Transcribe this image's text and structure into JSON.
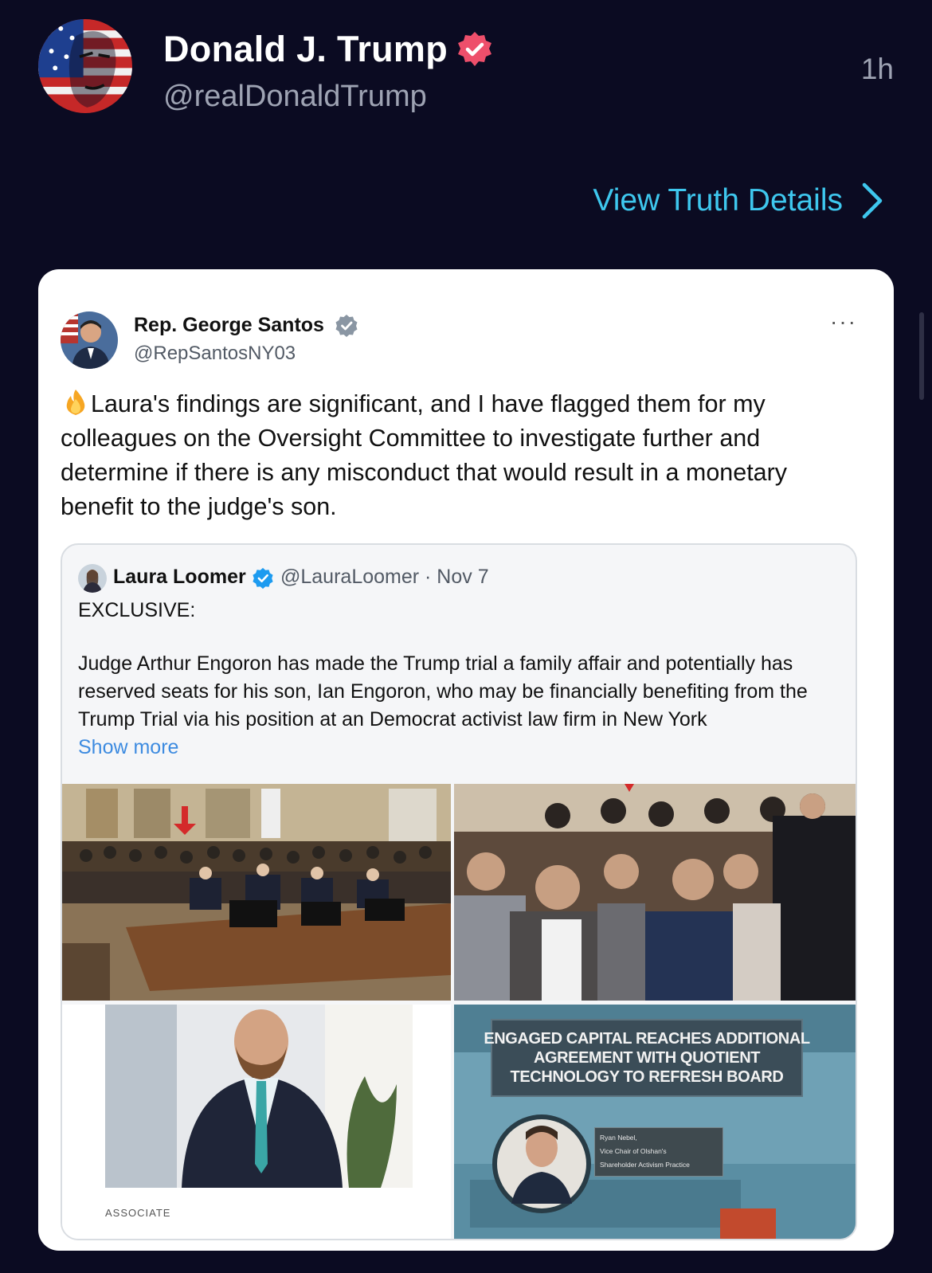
{
  "header": {
    "name": "Donald J. Trump",
    "handle": "@realDonaldTrump",
    "time": "1h",
    "view_details": "View Truth Details"
  },
  "colors": {
    "background": "#0b0b22",
    "accent_link": "#3ec7ee",
    "verified_badge": "#ee4f6b",
    "twitter_blue": "#1d9bf0"
  },
  "card": {
    "author": {
      "name": "Rep. George Santos",
      "handle": "@RepSantosNY03",
      "more": "···"
    },
    "body": "Laura's findings are significant, and I have flagged them for my colleagues on the Oversight Committee to investigate further and determine if there is any misconduct that would result in a monetary benefit to the judge's son.",
    "quote": {
      "name": "Laura Loomer",
      "handle_date": "@LauraLoomer · Nov 7",
      "headline": "EXCLUSIVE:",
      "text": "Judge Arthur Engoron has made the Trump trial a family affair and potentially has reserved seats for his son, Ian Engoron, who may be financially benefiting from the Trump Trial via his position at an Democrat activist law firm in New York",
      "show_more": "Show more",
      "images": {
        "associate_label": "ASSOCIATE",
        "news_headline": [
          "ENGAGED CAPITAL REACHES ADDITIONAL",
          "AGREEMENT WITH QUOTIENT",
          "TECHNOLOGY TO REFRESH BOARD"
        ],
        "caption": [
          "Ryan Nebel,",
          "Vice Chair of Olshan's",
          "Shareholder Activism Practice"
        ]
      }
    }
  }
}
